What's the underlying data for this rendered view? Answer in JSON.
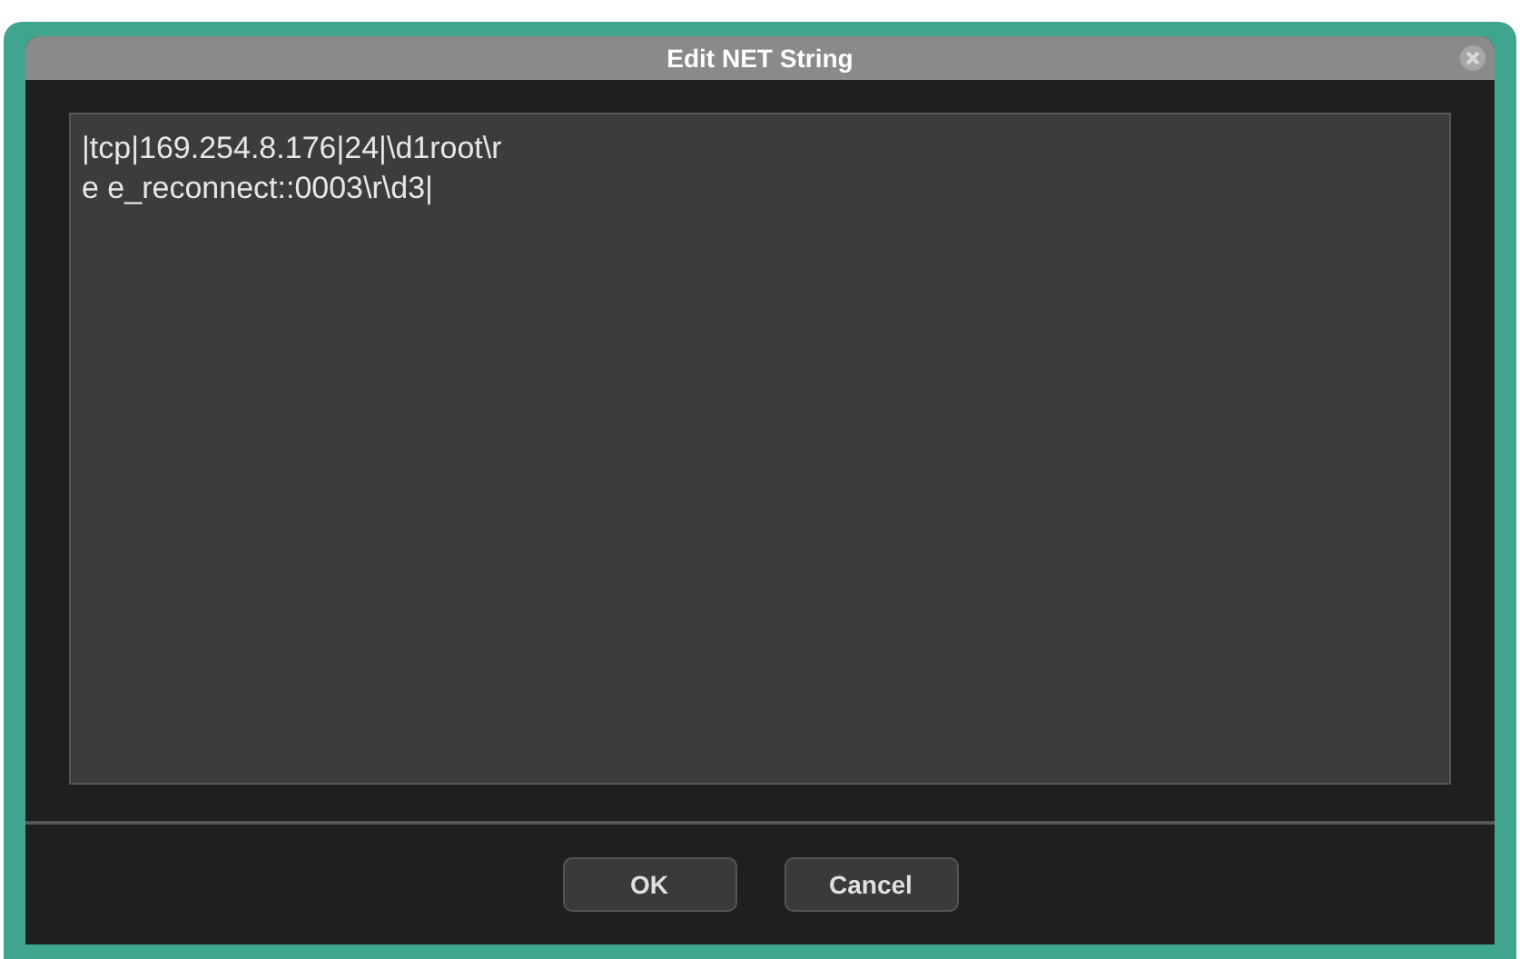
{
  "window": {
    "title": "Edit NET String"
  },
  "editor": {
    "value": "|tcp|169.254.8.176|24|\\d1root\\r\ne e_reconnect::0003\\r\\d3|"
  },
  "buttons": [
    {
      "label": "OK"
    },
    {
      "label": "Cancel"
    }
  ]
}
